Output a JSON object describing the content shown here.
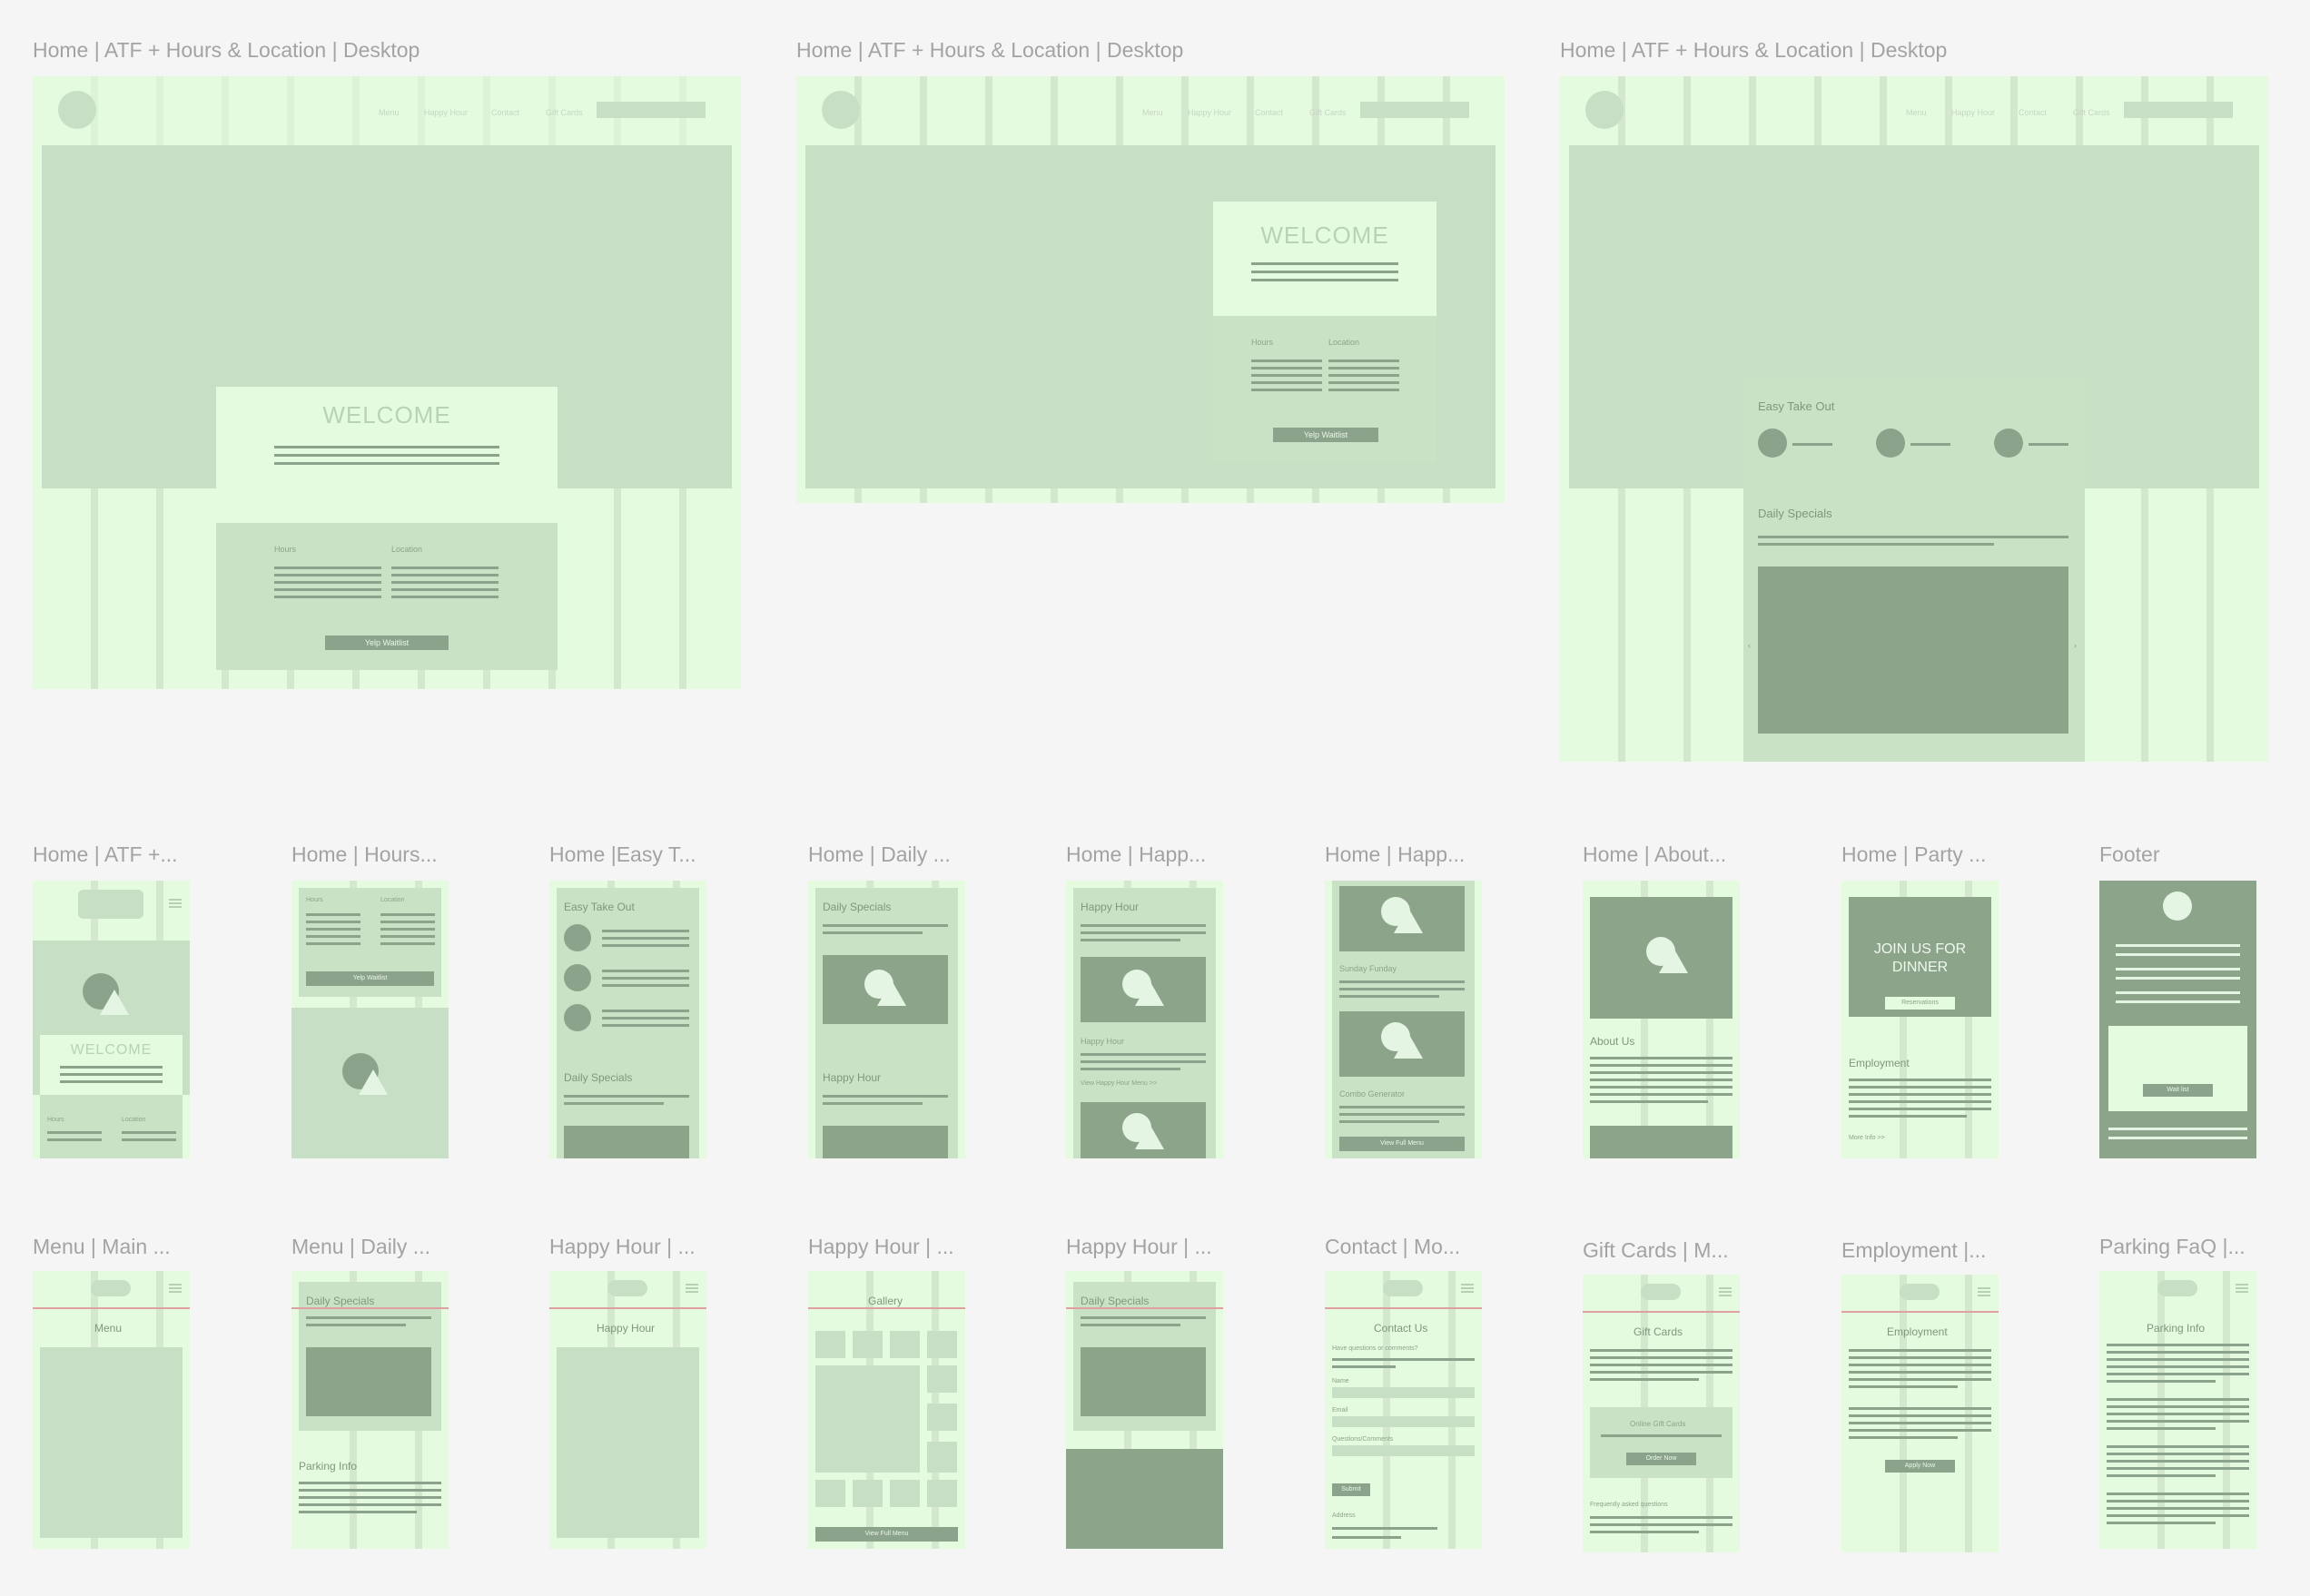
{
  "labels": {
    "top1": "Home | ATF + Hours & Location | Desktop",
    "top2": "Home | ATF + Hours & Location | Desktop",
    "top3": "Home | ATF + Hours & Location | Desktop",
    "m1": "Home | ATF +...",
    "m2": "Home | Hours...",
    "m3": "Home |Easy T...",
    "m4": "Home | Daily ...",
    "m5": "Home | Happ...",
    "m6": "Home | Happ...",
    "m7": "Home | About...",
    "m8": "Home | Party ...",
    "m9": "Footer",
    "b1": "Menu | Main ...",
    "b2": "Menu | Daily ...",
    "b3": "Happy Hour | ...",
    "b4": "Happy Hour | ...",
    "b5": "Happy Hour | ...",
    "b6": "Contact | Mo...",
    "b7": "Gift Cards | M...",
    "b8": "Employment |...",
    "b9": "Parking FaQ |..."
  },
  "nav": {
    "menu": "Menu",
    "happy_hour": "Happy Hour",
    "contact": "Contact",
    "gift_cards": "Gift Cards"
  },
  "text": {
    "welcome": "WELCOME",
    "hours": "Hours",
    "location": "Location",
    "yelp_waitlist": "Yelp Waitlist",
    "easy_take_out": "Easy Take Out",
    "daily_specials": "Daily Specials",
    "happy_hour": "Happy Hour",
    "sunday_funday": "Sunday Funday",
    "view_happy_hour_menu": "View Happy Hour Menu >>",
    "combo_generator": "Combo Generator",
    "view_full_menu": "View Full Menu",
    "about_us": "About Us",
    "join_us": "JOIN US FOR DINNER",
    "reservations": "Reservations",
    "employment": "Employment",
    "more_info": "More Info >>",
    "wait_list": "Wait list",
    "menu": "Menu",
    "parking_info": "Parking Info",
    "gallery": "Gallery",
    "contact_us": "Contact Us",
    "have_questions": "Have questions or comments?",
    "name": "Name",
    "email": "Email",
    "questions_comments": "Questions/Comments",
    "submit": "Submit",
    "address": "Address",
    "gift_cards": "Gift Cards",
    "online_gift_cards": "Online Gift Cards",
    "order_now": "Order Now",
    "faq": "Frequently asked questions",
    "apply_now": "Apply Now",
    "parking_info_title": "Parking Info"
  },
  "colors": {
    "frame": "#e5fbe0",
    "column": "#d3e8cf",
    "hero": "#c7dfc5",
    "dark": "#8ba38a",
    "accent_line": "#e0a0a0"
  }
}
